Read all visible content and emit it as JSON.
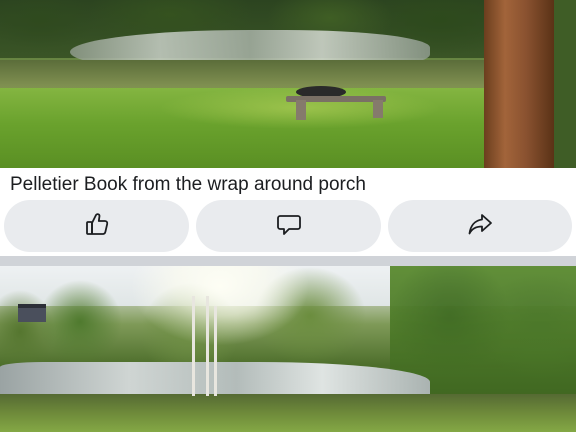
{
  "post": {
    "caption": "Pelletier Book from the wrap around porch",
    "photos": [
      {
        "description_icon": "photo"
      },
      {
        "description_icon": "photo"
      }
    ]
  },
  "actions": [
    {
      "id": "like",
      "icon": "thumbs-up-icon"
    },
    {
      "id": "comment",
      "icon": "comment-bubble-icon"
    },
    {
      "id": "share",
      "icon": "share-arrow-icon"
    }
  ],
  "colors": {
    "button_bg": "#e9ebee",
    "icon_stroke": "#1c1e21",
    "separator": "#d0d3d8",
    "caption_text": "#1c1e21"
  }
}
